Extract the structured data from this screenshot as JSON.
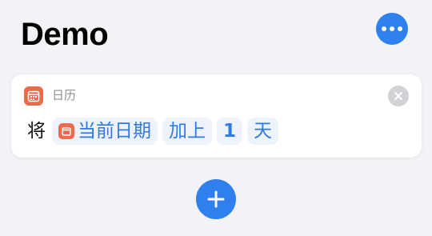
{
  "header": {
    "title": "Demo",
    "more_icon": "ellipsis-icon"
  },
  "action": {
    "app_name": "日历",
    "app_icon": "calendar-icon",
    "prefix": "将",
    "variable": {
      "label": "当前日期",
      "icon": "calendar-icon"
    },
    "operation": "加上",
    "amount": "1",
    "unit": "天",
    "close_icon": "close-icon"
  },
  "footer": {
    "add_icon": "plus-icon"
  },
  "colors": {
    "accent": "#2f80ed",
    "calendar": "#ee6a4e",
    "pill_bg": "#eef3fb",
    "pill_text": "#2f7ae5",
    "background": "#f2f2f7"
  }
}
